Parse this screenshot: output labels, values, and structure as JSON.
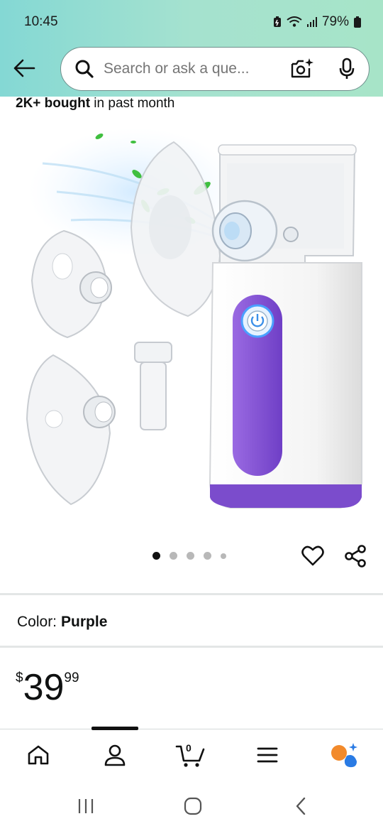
{
  "status": {
    "time": "10:45",
    "battery": "79%"
  },
  "search": {
    "placeholder": "Search or ask a que..."
  },
  "product": {
    "bought_bold": "2K+ bought",
    "bought_rest": " in past month",
    "image_count": 5,
    "active_image": 1,
    "color_label": "Color:",
    "color_value": "Purple",
    "price_symbol": "$",
    "price_whole": "39",
    "price_fraction": "99"
  },
  "bottom_nav": {
    "items": [
      "home-icon",
      "account-icon",
      "cart-icon",
      "menu-icon",
      "rufus-icon"
    ],
    "cart_count": "0",
    "active_index": 1
  },
  "colors": {
    "accent_purple": "#7e4fd0",
    "header_teal": "#84d8d4",
    "rufus_orange": "#f28a2b",
    "rufus_blue": "#2a7be4"
  }
}
